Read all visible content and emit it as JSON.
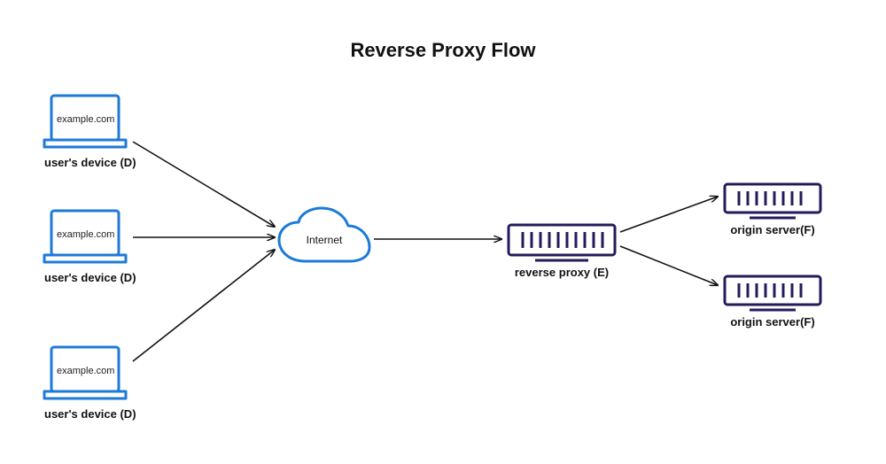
{
  "title": "Reverse Proxy Flow",
  "devices": [
    {
      "screen": "example.com",
      "label": "user's device (D)"
    },
    {
      "screen": "example.com",
      "label": "user's device (D)"
    },
    {
      "screen": "example.com",
      "label": "user's device (D)"
    }
  ],
  "cloud": {
    "label": "Internet"
  },
  "proxy": {
    "label": "reverse proxy (E)"
  },
  "servers": [
    {
      "label": "origin server(F)"
    },
    {
      "label": "origin server(F)"
    }
  ],
  "colors": {
    "device_blue": "#1d7ad8",
    "rack_purple": "#241b5a",
    "arrow": "#111111"
  }
}
